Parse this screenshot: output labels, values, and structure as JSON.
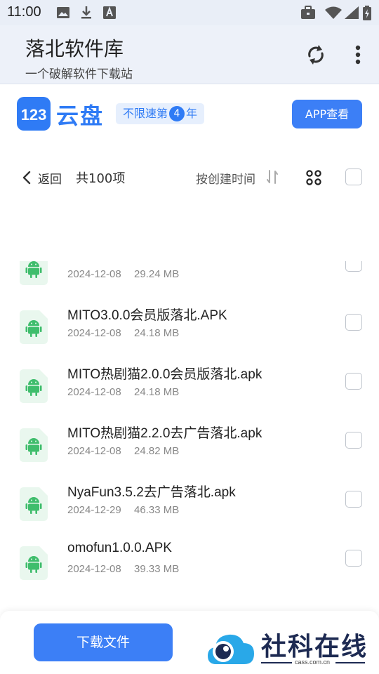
{
  "status_bar": {
    "time": "11:00",
    "left_icons": [
      "image-icon",
      "download-icon",
      "a-icon"
    ],
    "right_icons": [
      "briefcase-icon",
      "wifi-icon",
      "signal-icon",
      "battery-icon"
    ]
  },
  "header": {
    "title": "落北软件库",
    "subtitle": "一个破解软件下载站",
    "icons": [
      "refresh-icon",
      "more-vert-icon"
    ]
  },
  "brand": {
    "logo_text": "123",
    "name": "云盘",
    "badge_prefix": "不限速第",
    "badge_number": "4",
    "badge_suffix": "年",
    "app_button": "APP查看",
    "accent_color": "#3c7ff6"
  },
  "toolbar": {
    "back": "返回",
    "count": "共100项",
    "sort": "按创建时间"
  },
  "files": [
    {
      "name": "",
      "date": "2024-12-08",
      "size": "29.24 MB"
    },
    {
      "name": "MITO3.0.0会员版落北.APK",
      "date": "2024-12-08",
      "size": "24.18 MB"
    },
    {
      "name": "MITO热剧猫2.0.0会员版落北.apk",
      "date": "2024-12-08",
      "size": "24.18 MB"
    },
    {
      "name": "MITO热剧猫2.2.0去广告落北.apk",
      "date": "2024-12-08",
      "size": "24.82 MB"
    },
    {
      "name": "NyaFun3.5.2去广告落北.apk",
      "date": "2024-12-29",
      "size": "46.33 MB"
    },
    {
      "name": "omofun1.0.0.APK",
      "date": "2024-12-08",
      "size": "39.33 MB"
    }
  ],
  "bottom": {
    "download_button": "下载文件",
    "watermark_text": "社科在线",
    "watermark_url": "cass.com.cn"
  }
}
